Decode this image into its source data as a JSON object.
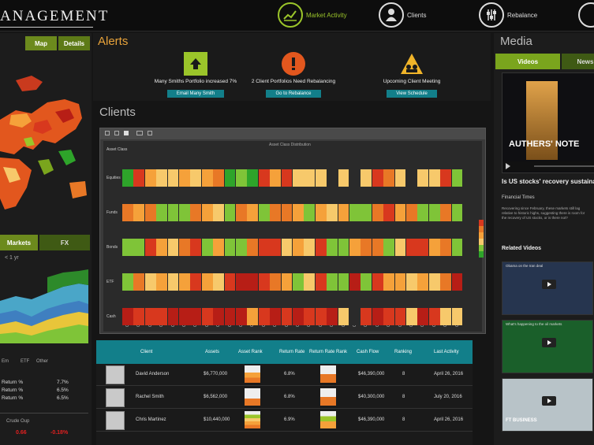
{
  "header": {
    "brand": "ANAGEMENT",
    "nav": [
      {
        "label": "Market Activity",
        "icon": "chart-line-icon",
        "active": true
      },
      {
        "label": "Clients",
        "icon": "person-icon",
        "active": false
      },
      {
        "label": "Rebalance",
        "icon": "sliders-icon",
        "active": false
      }
    ]
  },
  "left": {
    "tabs": [
      "Map",
      "Details"
    ],
    "market_tabs": [
      "Markets",
      "FX"
    ],
    "chart_caption": "< 1 yr",
    "legend": [
      "Em",
      "ETF",
      "Other"
    ],
    "returns": [
      {
        "label": "Return %",
        "value": "7.7%"
      },
      {
        "label": "Return %",
        "value": "6.5%"
      },
      {
        "label": "Return %",
        "value": "6.5%"
      }
    ],
    "footer_label": "Crude Oup",
    "footer_values": [
      "0.66",
      "-0.18%"
    ]
  },
  "alerts": {
    "title": "Alerts",
    "items": [
      {
        "icon": "arrow-up-icon",
        "text": "Many Smiths Portfolio increased 7%",
        "button": "Email Many Smith",
        "color": "#9bc52a"
      },
      {
        "icon": "exclamation-icon",
        "text": "2 Client Portfolios Need Rebalancing",
        "button": "Go to Rebalance",
        "color": "#e2571e"
      },
      {
        "icon": "warning-icon",
        "text": "Upcoming Client Meeting",
        "button": "View Schedule",
        "color": "#f0b429"
      }
    ]
  },
  "clients": {
    "title": "Clients",
    "heatmap_title": "Asset Class Distribution",
    "rows": [
      "Equities",
      "Funds",
      "Bonds",
      "ETF",
      "Cash"
    ],
    "row_header": "Asset Class",
    "columns": [
      "Client A",
      "Client B",
      "Client C",
      "Client D",
      "Client E",
      "Client F",
      "Client G",
      "Client H",
      "Client I",
      "Client J",
      "Client K",
      "Client L",
      "Client M",
      "Client N",
      "Client O",
      "Client P",
      "Client Q",
      "Client R",
      "Client S",
      "Client T",
      "Client U",
      "Client V",
      "Client W",
      "Client X",
      "Client Y",
      "Client Z",
      "Client AA",
      "Client AB",
      "Client AC",
      "Client AD"
    ],
    "palette": {
      "dg": "#2ea42a",
      "lg": "#7fc438",
      "y": "#f7c96b",
      "o": "#f5a13a",
      "do": "#e87826",
      "r": "#d8381e",
      "dr": "#b71e16",
      "e": "#2a2a2a"
    },
    "grid": [
      [
        "dg",
        "r",
        "o",
        "y",
        "y",
        "o",
        "y",
        "o",
        "do",
        "dg",
        "lg",
        "dg",
        "r",
        "o",
        "r",
        "y",
        "y",
        "y",
        "e",
        "y",
        "e",
        "y",
        "r",
        "do",
        "y",
        "e",
        "y",
        "y",
        "r",
        "lg"
      ],
      [
        "do",
        "o",
        "do",
        "lg",
        "lg",
        "lg",
        "do",
        "o",
        "y",
        "lg",
        "do",
        "o",
        "lg",
        "do",
        "do",
        "o",
        "lg",
        "o",
        "y",
        "o",
        "lg",
        "lg",
        "do",
        "r",
        "o",
        "do",
        "lg",
        "lg",
        "do",
        "lg"
      ],
      [
        "lg",
        "lg",
        "r",
        "o",
        "y",
        "do",
        "r",
        "lg",
        "o",
        "lg",
        "lg",
        "do",
        "r",
        "r",
        "y",
        "o",
        "y",
        "r",
        "lg",
        "lg",
        "o",
        "do",
        "do",
        "lg",
        "y",
        "r",
        "r",
        "o",
        "do",
        "lg"
      ],
      [
        "lg",
        "do",
        "y",
        "o",
        "y",
        "o",
        "r",
        "o",
        "y",
        "r",
        "dr",
        "dr",
        "r",
        "do",
        "o",
        "lg",
        "y",
        "r",
        "lg",
        "lg",
        "dr",
        "lg",
        "r",
        "o",
        "o",
        "y",
        "o",
        "y",
        "do",
        "dr"
      ],
      [
        "dr",
        "r",
        "r",
        "r",
        "dr",
        "dr",
        "dr",
        "r",
        "dr",
        "dr",
        "dr",
        "o",
        "r",
        "dr",
        "r",
        "dr",
        "r",
        "r",
        "dr",
        "y",
        "e",
        "r",
        "dr",
        "r",
        "r",
        "y",
        "dr",
        "r",
        "y",
        "y"
      ]
    ]
  },
  "table": {
    "headers": [
      "Client",
      "Assets",
      "Asset Rank",
      "Return Rate",
      "Return Rate Rank",
      "Cash Flow",
      "Ranking",
      "Last Activity"
    ],
    "rows": [
      {
        "name": "David Anderson",
        "assets": "$6,770,000",
        "return": "6.8%",
        "cash": "$46,390,000",
        "ranking": "8",
        "last": "April 26, 2016"
      },
      {
        "name": "Rachel Smith",
        "assets": "$6,562,000",
        "return": "6.8%",
        "cash": "$40,300,000",
        "ranking": "8",
        "last": "July 20, 2016"
      },
      {
        "name": "Chris Martinez",
        "assets": "$10,440,000",
        "return": "6.9%",
        "cash": "$46,390,000",
        "ranking": "8",
        "last": "April 26, 2016"
      }
    ]
  },
  "media": {
    "title": "Media",
    "tabs": [
      "Videos",
      "News"
    ],
    "main_video": {
      "overlay": "AUTHERS' NOTE",
      "headline": "Is US stocks' recovery sustainable",
      "source": "Financial Times",
      "blurb": "Recovering since February, these markets still lag relative to historic highs, suggesting there is room for the recovery of US stocks, or is there not?"
    },
    "related_title": "Related Videos",
    "related": [
      {
        "label": "Obama on the Iran deal",
        "color": "#26354f"
      },
      {
        "label": "What's happening to the oil markets",
        "color": "#1a5f2a"
      },
      {
        "label": "FT BUSINESS",
        "color": "#b8c3c8"
      }
    ]
  }
}
